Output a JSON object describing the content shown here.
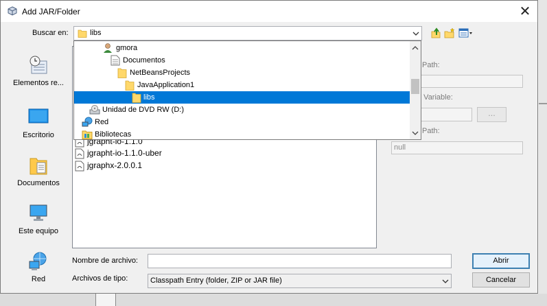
{
  "window": {
    "title": "Add JAR/Folder"
  },
  "lookin": {
    "label": "Buscar en:",
    "value": "libs"
  },
  "places": [
    {
      "label": "Elementos re...",
      "icon": "recent-items-icon"
    },
    {
      "label": "Escritorio",
      "icon": "desktop-icon"
    },
    {
      "label": "Documentos",
      "icon": "documents-icon"
    },
    {
      "label": "Este equipo",
      "icon": "computer-icon"
    },
    {
      "label": "Red",
      "icon": "network-icon"
    }
  ],
  "dropdown": {
    "items": [
      {
        "label": "gmora",
        "icon": "user-icon"
      },
      {
        "label": "Documentos",
        "icon": "document-icon"
      },
      {
        "label": "NetBeansProjects",
        "icon": "folder-icon"
      },
      {
        "label": "JavaApplication1",
        "icon": "folder-icon"
      },
      {
        "label": "libs",
        "icon": "folder-icon"
      },
      {
        "label": "Unidad de DVD RW (D:)",
        "icon": "dvd-drive-icon"
      },
      {
        "label": "Red",
        "icon": "network-icon"
      },
      {
        "label": "Bibliotecas",
        "icon": "libraries-icon"
      }
    ],
    "selected": "libs"
  },
  "files": [
    {
      "name": "jgrapht-io-1.1.0"
    },
    {
      "name": "jgrapht-io-1.1.0-uber"
    },
    {
      "name": "jgraphx-2.0.0.1"
    }
  ],
  "right_panel": {
    "label1": "Path:",
    "label2": "n Variable:",
    "label3": "Path:",
    "browse_label": "...",
    "field3_value": "null"
  },
  "filename": {
    "label": "Nombre de archivo:",
    "value": ""
  },
  "filetype": {
    "label": "Archivos de tipo:",
    "value": "Classpath Entry (folder, ZIP or JAR file)"
  },
  "buttons": {
    "open": "Abrir",
    "cancel": "Cancelar"
  },
  "colors": {
    "selection": "#0078d7",
    "default_button_border": "#3c7fb1"
  }
}
